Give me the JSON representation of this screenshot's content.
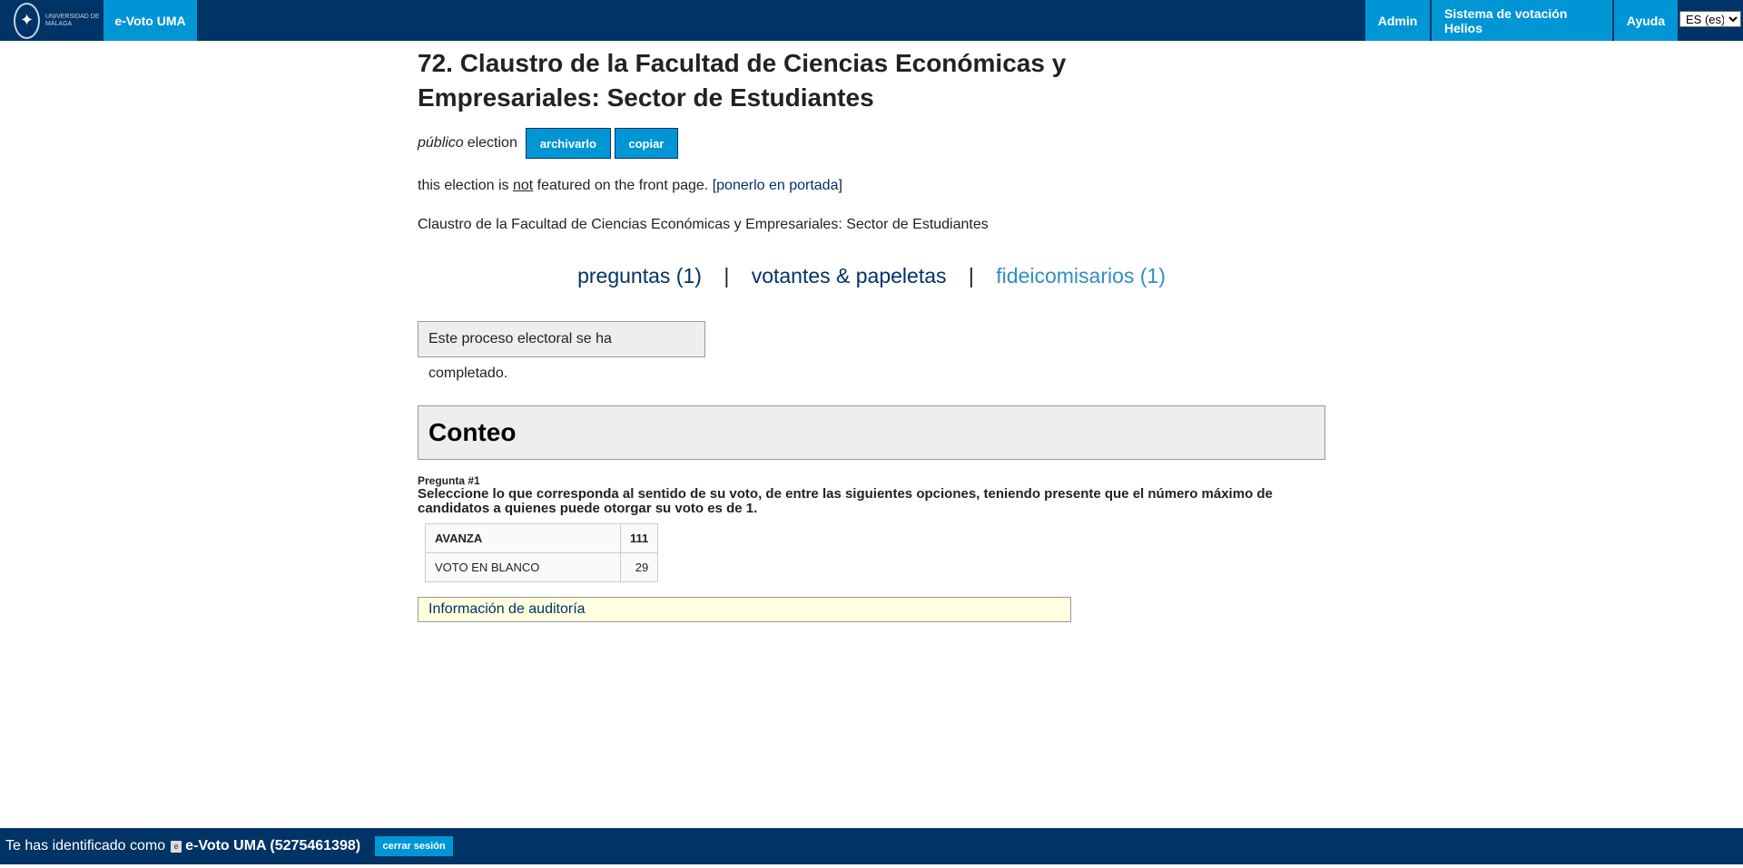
{
  "header": {
    "logo_text": "UNIVERSIDAD DE MÁLAGA",
    "brand": "e-Voto UMA",
    "nav": {
      "admin": "Admin",
      "helios": "Sistema de votación Helios",
      "ayuda": "Ayuda"
    },
    "language": "ES (es)"
  },
  "election": {
    "title": "72. Claustro de la Facultad de Ciencias Económicas y Empresariales: Sector de Estudiantes",
    "visibility": "público",
    "visibility_suffix": "election",
    "archive_button": "archivarlo",
    "copy_button": "copiar",
    "featured_prefix": "this election is",
    "featured_not": "not",
    "featured_suffix": "featured on the front page. [",
    "featured_link": "ponerlo en portada",
    "featured_close": "]",
    "description": "Claustro de la Facultad de Ciencias Económicas y Empresariales: Sector de Estudiantes"
  },
  "tabs": {
    "questions": "preguntas (1)",
    "voters": "votantes & papeletas",
    "trustees": "fideicomisarios (1)",
    "separator": "|"
  },
  "status": {
    "completed": "Este proceso electoral se ha completado."
  },
  "tally": {
    "heading": "Conteo",
    "question_label": "Pregunta #1",
    "question_text": "Seleccione lo que corresponda al sentido de su voto, de entre las siguientes opciones, teniendo presente que el número máximo de candidatos a quienes puede otorgar su voto es de 1.",
    "results": [
      {
        "name": "AVANZA",
        "count": "111"
      },
      {
        "name": "VOTO EN BLANCO",
        "count": "29"
      }
    ]
  },
  "audit": {
    "label": "Información de auditoría"
  },
  "footer": {
    "logged_in_as": "Te has identificado como",
    "user": "e-Voto UMA (5275461398)",
    "logout": "cerrar sesión"
  }
}
